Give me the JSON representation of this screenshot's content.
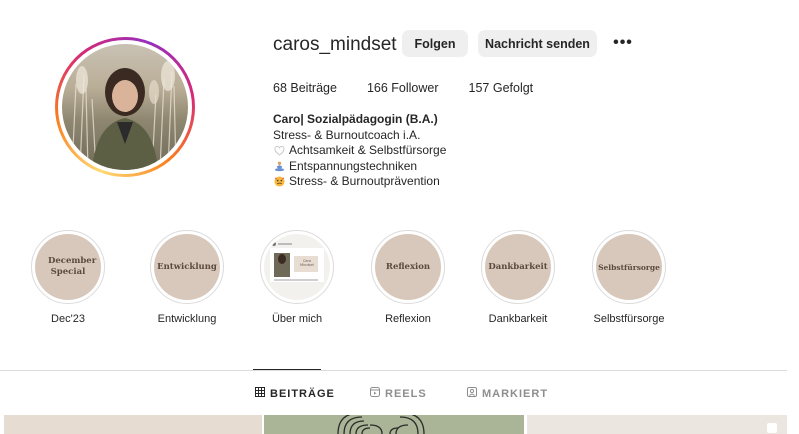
{
  "profile": {
    "username": "caros_mindset",
    "follow_label": "Folgen",
    "message_label": "Nachricht senden",
    "more_label": "•••"
  },
  "stats": {
    "posts": "68 Beiträge",
    "followers": "166 Follower",
    "following": "157 Gefolgt"
  },
  "bio": {
    "name": "Caro| Sozialpädagogin (B.A.)",
    "line1": "Stress- & Burnoutcoach i.A.",
    "line2": "Achtsamkeit & Selbstfürsorge",
    "line3": "Entspannungstechniken",
    "line4": "Stress- & Burnoutprävention",
    "icon2": "heart-outline-icon",
    "icon3": "meditation-emoji",
    "icon4": "stressed-face-emoji"
  },
  "highlights": [
    {
      "cover_text": "December Special",
      "label": "Dec'23"
    },
    {
      "cover_text": "Entwicklung",
      "label": "Entwicklung"
    },
    {
      "cover_text": "",
      "label": "Über mich",
      "photo_caption": "Caro Mindset"
    },
    {
      "cover_text": "Reflexion",
      "label": "Reflexion"
    },
    {
      "cover_text": "Dankbarkeit",
      "label": "Dankbarkeit"
    },
    {
      "cover_text": "Selbstfürsorge",
      "label": "Selbstfürsorge"
    }
  ],
  "tabs": {
    "posts": "BEITRÄGE",
    "reels": "REELS",
    "tagged": "MARKIERT"
  },
  "colors": {
    "highlight_bg": "#d8c8bb",
    "highlight_text": "#5a4a3f",
    "button_bg": "#efefef"
  }
}
